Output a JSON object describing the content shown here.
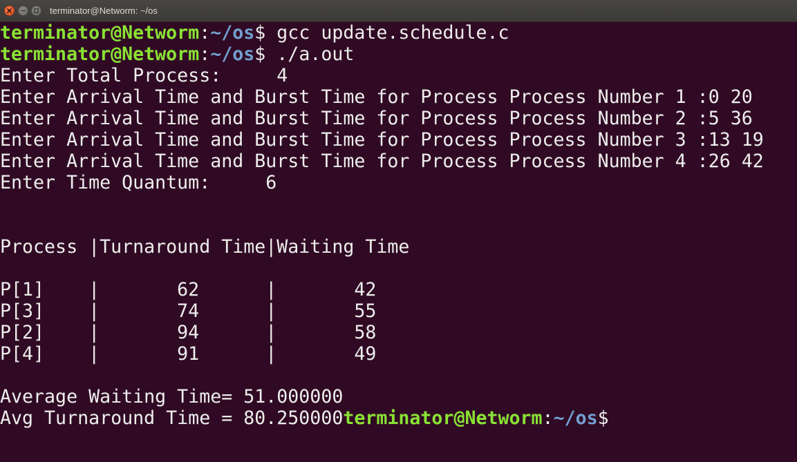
{
  "window": {
    "title": "terminator@Networm: ~/os"
  },
  "prompt": {
    "user_host": "terminator@Networm",
    "colon": ":",
    "path": "~/os",
    "dollar": "$"
  },
  "commands": {
    "cmd1": " gcc update.schedule.c",
    "cmd2": " ./a.out"
  },
  "output": {
    "total_process": "Enter Total Process:     4",
    "arrival_1": "Enter Arrival Time and Burst Time for Process Process Number 1 :0 20",
    "arrival_2": "Enter Arrival Time and Burst Time for Process Process Number 2 :5 36",
    "arrival_3": "Enter Arrival Time and Burst Time for Process Process Number 3 :13 19",
    "arrival_4": "Enter Arrival Time and Burst Time for Process Process Number 4 :26 42",
    "quantum": "Enter Time Quantum:     6",
    "table_header": "Process |Turnaround Time|Waiting Time",
    "rows": [
      "P[1]    |       62      |       42",
      "P[3]    |       74      |       55",
      "P[2]    |       94      |       58",
      "P[4]    |       91      |       49"
    ],
    "avg_waiting": "Average Waiting Time= 51.000000",
    "avg_turnaround": "Avg Turnaround Time = 80.250000"
  },
  "colors": {
    "background": "#300a24",
    "prompt_user": "#8ae234",
    "prompt_path": "#729fcf",
    "text": "#eeeeec"
  },
  "icons": [
    "close-icon",
    "minimize-icon",
    "maximize-icon"
  ]
}
